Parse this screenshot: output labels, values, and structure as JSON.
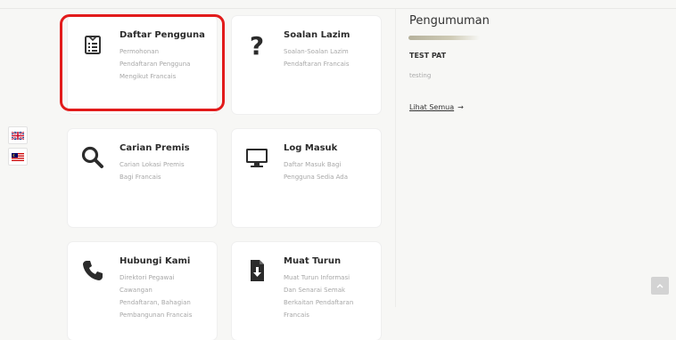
{
  "languages": [
    {
      "code": "en",
      "icon": "uk-flag-icon"
    },
    {
      "code": "ms",
      "icon": "malaysia-flag-icon"
    }
  ],
  "cards": [
    {
      "id": "daftar-pengguna",
      "icon": "register-form-icon",
      "title": "Daftar Pengguna",
      "desc": [
        "Permohonan",
        "Pendaftaran Pengguna",
        "Mengikut Francais"
      ]
    },
    {
      "id": "soalan-lazim",
      "icon": "question-mark-icon",
      "title": "Soalan Lazim",
      "desc": [
        "Soalan-Soalan Lazim",
        "Pendaftaran Francais"
      ]
    },
    {
      "id": "carian-premis",
      "icon": "search-icon",
      "title": "Carian Premis",
      "desc": [
        "Carian Lokasi Premis",
        "Bagi Francais"
      ]
    },
    {
      "id": "log-masuk",
      "icon": "monitor-icon",
      "title": "Log Masuk",
      "desc": [
        "Daftar Masuk Bagi",
        "Pengguna Sedia Ada"
      ]
    },
    {
      "id": "hubungi-kami",
      "icon": "phone-icon",
      "title": "Hubungi Kami",
      "desc": [
        "Direktori Pegawai",
        "Cawangan",
        "Pendaftaran, Bahagian",
        "Pembangunan Francais"
      ]
    },
    {
      "id": "muat-turun",
      "icon": "download-file-icon",
      "title": "Muat Turun",
      "desc": [
        "Muat Turun Informasi",
        "Dan Senarai Semak",
        "Berkaitan Pendaftaran",
        "Francais"
      ]
    }
  ],
  "announcements": {
    "heading": "Pengumuman",
    "items": [
      {
        "title": "TEST PAT",
        "body": "testing"
      }
    ],
    "see_all_label": "Lihat Semua",
    "see_all_arrow": "→"
  },
  "colors": {
    "highlight": "#e21b1b",
    "scroll_top_bg": "#d3d3d3"
  }
}
